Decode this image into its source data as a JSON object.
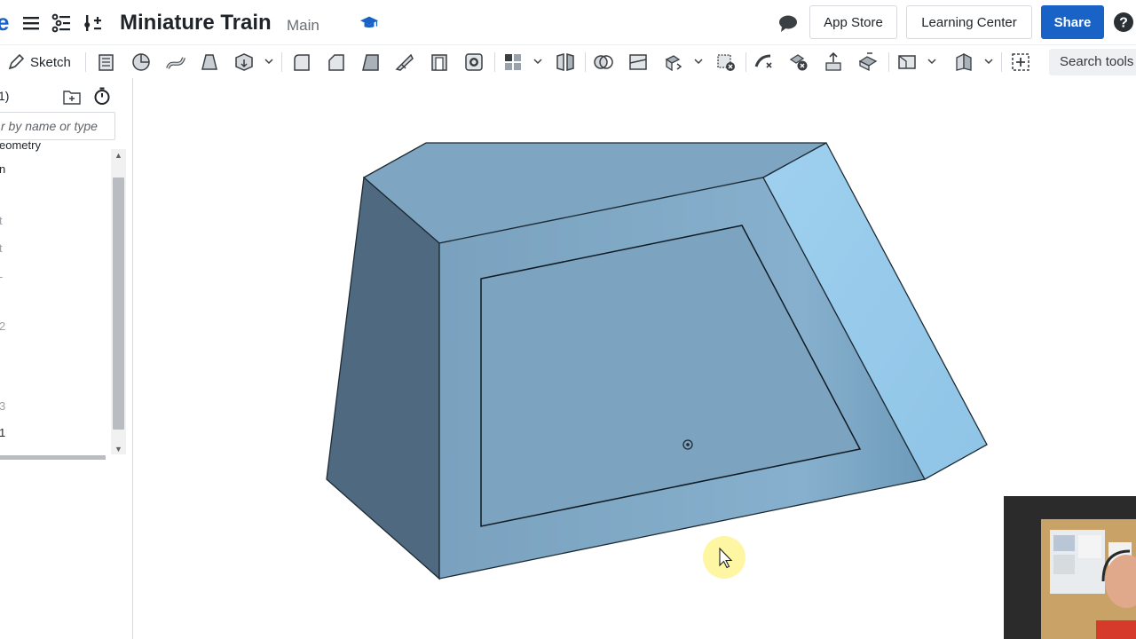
{
  "header": {
    "document_title": "Miniature Train",
    "branch": "Main",
    "buttons": {
      "app_store": "App Store",
      "learning_center": "Learning Center",
      "share": "Share"
    },
    "logo_fragment": "e"
  },
  "toolbar": {
    "sketch_label": "Sketch",
    "search_label": "Search tools"
  },
  "feature_panel": {
    "title_fragment": "1)",
    "filter_placeholder": "r by name or type",
    "items": [
      {
        "label": "eometry",
        "dim": false
      },
      {
        "label": "n",
        "dim": false
      },
      {
        "label": "t",
        "dim": true
      },
      {
        "label": "t",
        "dim": true
      },
      {
        "label": "-",
        "dim": true
      },
      {
        "label": "2",
        "dim": true
      },
      {
        "label": "3",
        "dim": true
      },
      {
        "label": "1",
        "dim": false
      }
    ]
  },
  "colors": {
    "brand_blue": "#1a63c6",
    "face_top": "#7ca3bf",
    "face_left": "#4f6a80",
    "face_front": "#7ea6c3",
    "face_right": "#96c8e8",
    "cursor_highlight": "#fff59a"
  }
}
